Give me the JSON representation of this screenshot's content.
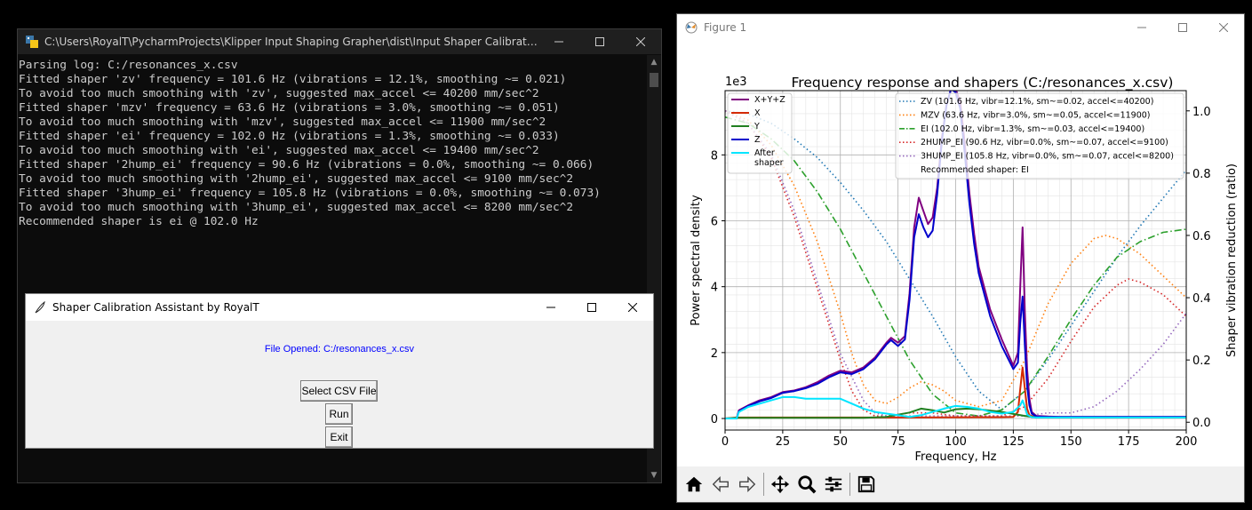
{
  "console": {
    "title": "C:\\Users\\RoyalT\\PycharmProjects\\Klipper Input Shaping Grapher\\dist\\Input Shaper Calibration Assistan...",
    "lines": [
      "Parsing log: C:/resonances_x.csv",
      "Fitted shaper 'zv' frequency = 101.6 Hz (vibrations = 12.1%, smoothing ~= 0.021)",
      "To avoid too much smoothing with 'zv', suggested max_accel <= 40200 mm/sec^2",
      "Fitted shaper 'mzv' frequency = 63.6 Hz (vibrations = 3.0%, smoothing ~= 0.051)",
      "To avoid too much smoothing with 'mzv', suggested max_accel <= 11900 mm/sec^2",
      "Fitted shaper 'ei' frequency = 102.0 Hz (vibrations = 1.3%, smoothing ~= 0.033)",
      "To avoid too much smoothing with 'ei', suggested max_accel <= 19400 mm/sec^2",
      "Fitted shaper '2hump_ei' frequency = 90.6 Hz (vibrations = 0.0%, smoothing ~= 0.066)",
      "To avoid too much smoothing with '2hump_ei', suggested max_accel <= 9100 mm/sec^2",
      "Fitted shaper '3hump_ei' frequency = 105.8 Hz (vibrations = 0.0%, smoothing ~= 0.073)",
      "To avoid too much smoothing with '3hump_ei', suggested max_accel <= 8200 mm/sec^2",
      "Recommended shaper is ei @ 102.0 Hz"
    ]
  },
  "dialog": {
    "title": "Shaper Calibration Assistant by RoyalT",
    "file_opened": "File Opened: C:/resonances_x.csv",
    "select_button": "Select CSV File",
    "run_button": "Run",
    "exit_button": "Exit"
  },
  "figure": {
    "title": "Figure 1"
  },
  "colors": {
    "console_bg": "#0c0c0c",
    "console_text": "#cccccc",
    "link_blue": "#0000ff"
  },
  "chart_data": {
    "type": "line",
    "title": "Frequency response and shapers (C:/resonances_x.csv)",
    "xlabel": "Frequency, Hz",
    "ylabel": "Power spectral density",
    "y2label": "Shaper vibration reduction (ratio)",
    "y_offset_label": "1e3",
    "xlim": [
      0,
      200
    ],
    "ylim": [
      -0.35,
      9.95
    ],
    "y2lim": [
      -0.025,
      1.065
    ],
    "xticks": [
      0,
      25,
      50,
      75,
      100,
      125,
      150,
      175,
      200
    ],
    "yticks": [
      0,
      2,
      4,
      6,
      8
    ],
    "y2ticks": [
      0.0,
      0.2,
      0.4,
      0.6,
      0.8,
      1.0
    ],
    "grid": true,
    "legend_left_placement": "upper-left",
    "legend_right_placement": "upper-right",
    "recommended_text": "Recommended shaper: EI",
    "psd_series": [
      {
        "name": "X+Y+Z",
        "color": "#800080",
        "x": [
          0,
          5,
          6,
          10,
          15,
          20,
          25,
          30,
          35,
          40,
          45,
          50,
          55,
          60,
          65,
          70,
          72,
          75,
          78,
          80,
          82,
          84,
          86,
          88,
          90,
          92,
          94,
          96,
          98,
          100,
          102,
          104,
          106,
          108,
          110,
          115,
          120,
          125,
          127,
          128,
          129,
          130,
          131,
          132,
          133,
          135,
          140,
          145,
          150,
          175,
          200
        ],
        "y": [
          0,
          0,
          0.25,
          0.4,
          0.55,
          0.65,
          0.8,
          0.85,
          0.95,
          1.1,
          1.3,
          1.45,
          1.4,
          1.55,
          1.85,
          2.3,
          2.45,
          2.3,
          2.5,
          3.8,
          5.8,
          6.7,
          6.3,
          5.9,
          6.1,
          7.0,
          8.5,
          9.5,
          10,
          10,
          9.6,
          8.3,
          6.8,
          5.6,
          4.6,
          3.3,
          2.4,
          1.6,
          2.0,
          4.0,
          5.8,
          3.2,
          1.5,
          0.6,
          0.2,
          0.08,
          0.06,
          0.05,
          0.05,
          0.05,
          0.05
        ]
      },
      {
        "name": "X",
        "color": "#d42a00",
        "x": [
          0,
          5,
          70,
          120,
          125,
          127,
          128,
          129,
          130,
          131,
          132,
          135,
          200
        ],
        "y": [
          0,
          0.03,
          0.03,
          0.04,
          0.05,
          0.2,
          0.9,
          1.55,
          0.9,
          0.3,
          0.1,
          0.03,
          0.03
        ]
      },
      {
        "name": "Y",
        "color": "#208020",
        "x": [
          0,
          5,
          60,
          70,
          80,
          85,
          90,
          95,
          100,
          105,
          110,
          120,
          130,
          135,
          200
        ],
        "y": [
          0,
          0.02,
          0.02,
          0.05,
          0.18,
          0.3,
          0.25,
          0.18,
          0.28,
          0.3,
          0.28,
          0.2,
          0.08,
          0.03,
          0.03
        ]
      },
      {
        "name": "Z",
        "color": "#0000cc",
        "x": [
          0,
          5,
          6,
          10,
          15,
          20,
          25,
          30,
          35,
          40,
          45,
          50,
          55,
          60,
          65,
          70,
          72,
          75,
          78,
          80,
          82,
          84,
          86,
          88,
          90,
          92,
          94,
          96,
          98,
          100,
          102,
          104,
          106,
          108,
          110,
          115,
          120,
          125,
          127,
          128,
          129,
          130,
          131,
          132,
          133,
          135,
          140,
          150,
          200
        ],
        "y": [
          0,
          0,
          0.22,
          0.38,
          0.52,
          0.62,
          0.78,
          0.83,
          0.92,
          1.05,
          1.25,
          1.4,
          1.35,
          1.5,
          1.8,
          2.25,
          2.38,
          2.2,
          2.4,
          3.6,
          5.5,
          6.2,
          5.8,
          5.5,
          5.7,
          6.8,
          8.4,
          9.5,
          10,
          9.9,
          9.4,
          8.0,
          6.5,
          5.3,
          4.4,
          3.1,
          2.2,
          1.5,
          1.7,
          2.9,
          3.7,
          2.2,
          1.0,
          0.4,
          0.15,
          0.06,
          0.05,
          0.05,
          0.05
        ]
      },
      {
        "name": "After\nshaper",
        "color": "#00e5ff",
        "x": [
          0,
          5,
          6,
          10,
          15,
          20,
          25,
          30,
          35,
          40,
          45,
          50,
          55,
          60,
          65,
          70,
          75,
          80,
          85,
          90,
          95,
          100,
          105,
          110,
          115,
          120,
          125,
          128,
          129,
          130,
          131,
          133,
          135,
          150,
          200
        ],
        "y": [
          0,
          0,
          0.2,
          0.35,
          0.45,
          0.55,
          0.65,
          0.65,
          0.6,
          0.6,
          0.6,
          0.6,
          0.45,
          0.3,
          0.2,
          0.15,
          0.1,
          0.05,
          0.1,
          0.2,
          0.3,
          0.38,
          0.35,
          0.3,
          0.2,
          0.15,
          0.2,
          0.4,
          0.55,
          0.35,
          0.12,
          0.04,
          0.03,
          0.03,
          0.03
        ]
      }
    ],
    "shaper_series": [
      {
        "name": "ZV (101.6 Hz, vibr=12.1%, sm~=0.02, accel<=40200)",
        "color": "#1f77b4",
        "style": "dotted",
        "x": [
          0,
          10,
          20,
          30,
          40,
          50,
          60,
          70,
          80,
          90,
          100,
          110,
          120,
          130,
          140,
          150,
          160,
          170,
          180,
          190,
          200
        ],
        "y": [
          1.0,
          0.99,
          0.96,
          0.91,
          0.85,
          0.77,
          0.68,
          0.58,
          0.46,
          0.34,
          0.21,
          0.1,
          0.04,
          0.1,
          0.2,
          0.31,
          0.42,
          0.53,
          0.63,
          0.72,
          0.81
        ]
      },
      {
        "name": "MZV (63.6 Hz, vibr=3.0%, sm~=0.05, accel<=11900)",
        "color": "#ff7f0e",
        "style": "dotted",
        "x": [
          0,
          10,
          20,
          30,
          40,
          50,
          55,
          60,
          65,
          70,
          75,
          80,
          85,
          90,
          95,
          100,
          110,
          120,
          130,
          140,
          150,
          160,
          165,
          170,
          180,
          190,
          200
        ],
        "y": [
          1.0,
          0.97,
          0.89,
          0.76,
          0.58,
          0.35,
          0.22,
          0.12,
          0.07,
          0.06,
          0.08,
          0.11,
          0.13,
          0.12,
          0.1,
          0.07,
          0.05,
          0.07,
          0.2,
          0.38,
          0.51,
          0.59,
          0.6,
          0.59,
          0.54,
          0.47,
          0.4
        ]
      },
      {
        "name": "EI (102.0 Hz, vibr=1.3%, sm~=0.03, accel<=19400)",
        "color": "#2ca02c",
        "style": "dashdot",
        "x": [
          0,
          10,
          20,
          30,
          40,
          50,
          60,
          70,
          80,
          90,
          100,
          110,
          120,
          125,
          130,
          140,
          150,
          160,
          170,
          180,
          190,
          200
        ],
        "y": [
          0.98,
          0.96,
          0.91,
          0.84,
          0.74,
          0.62,
          0.48,
          0.34,
          0.2,
          0.09,
          0.03,
          0.02,
          0.04,
          0.07,
          0.1,
          0.21,
          0.33,
          0.44,
          0.53,
          0.58,
          0.61,
          0.62
        ]
      },
      {
        "name": "2HUMP_EI (90.6 Hz, vibr=0.0%, sm~=0.07, accel<=9100)",
        "color": "#d62728",
        "style": "dotted",
        "x": [
          0,
          10,
          20,
          30,
          40,
          50,
          55,
          60,
          65,
          70,
          80,
          90,
          100,
          110,
          120,
          130,
          140,
          150,
          160,
          170,
          175,
          180,
          190,
          200
        ],
        "y": [
          1.0,
          0.96,
          0.85,
          0.66,
          0.43,
          0.2,
          0.1,
          0.04,
          0.02,
          0.02,
          0.03,
          0.03,
          0.02,
          0.02,
          0.02,
          0.05,
          0.14,
          0.26,
          0.37,
          0.44,
          0.46,
          0.45,
          0.41,
          0.34
        ]
      },
      {
        "name": "3HUMP_EI (105.8 Hz, vibr=0.0%, sm~=0.07, accel<=8200)",
        "color": "#9467bd",
        "style": "dotted",
        "x": [
          0,
          10,
          20,
          30,
          40,
          50,
          60,
          65,
          70,
          80,
          90,
          100,
          110,
          120,
          130,
          140,
          150,
          160,
          170,
          180,
          190,
          200
        ],
        "y": [
          1.0,
          0.96,
          0.86,
          0.68,
          0.45,
          0.22,
          0.07,
          0.03,
          0.02,
          0.02,
          0.02,
          0.02,
          0.02,
          0.02,
          0.02,
          0.03,
          0.03,
          0.05,
          0.1,
          0.17,
          0.25,
          0.35
        ]
      }
    ]
  }
}
